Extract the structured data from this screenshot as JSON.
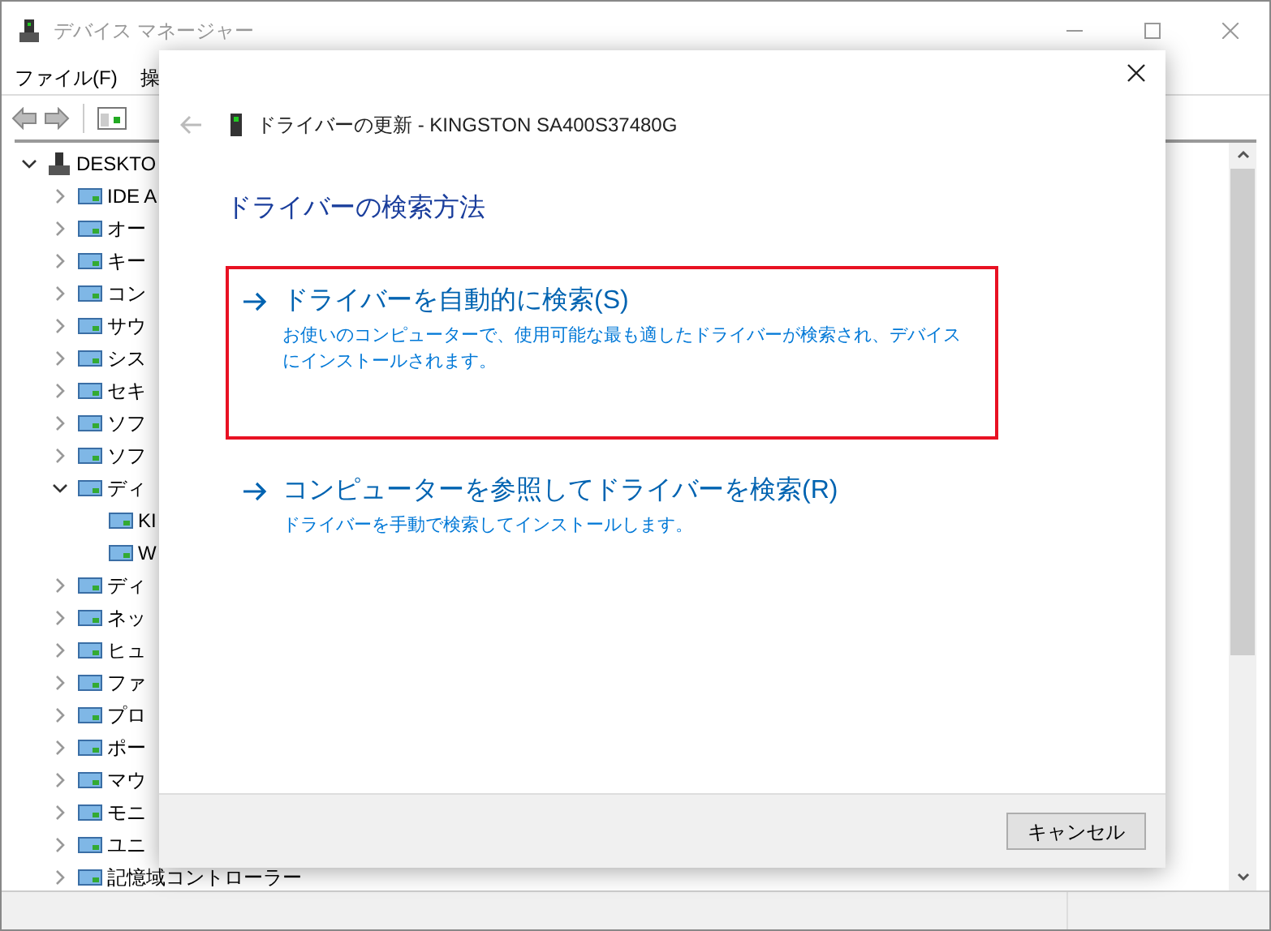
{
  "window": {
    "title": "デバイス マネージャー"
  },
  "menu": [
    "ファイル(F)",
    "操"
  ],
  "tree": [
    {
      "label": "DESKTO",
      "expanded": true,
      "children": [
        {
          "label": "IDE A",
          "expanded": false
        },
        {
          "label": "オー",
          "expanded": false
        },
        {
          "label": "キー",
          "expanded": false
        },
        {
          "label": "コン",
          "expanded": false
        },
        {
          "label": "サウ",
          "expanded": false
        },
        {
          "label": "シス",
          "expanded": false
        },
        {
          "label": "セキ",
          "expanded": false
        },
        {
          "label": "ソフ",
          "expanded": false
        },
        {
          "label": "ソフ",
          "expanded": false
        },
        {
          "label": "ディ",
          "expanded": true,
          "children": [
            {
              "label": "KI"
            },
            {
              "label": "W"
            }
          ]
        },
        {
          "label": "ディ",
          "expanded": false
        },
        {
          "label": "ネッ",
          "expanded": false
        },
        {
          "label": "ヒュ",
          "expanded": false
        },
        {
          "label": "ファ",
          "expanded": false
        },
        {
          "label": "プロ",
          "expanded": false
        },
        {
          "label": "ポー",
          "expanded": false
        },
        {
          "label": "マウ",
          "expanded": false
        },
        {
          "label": "モニ",
          "expanded": false
        },
        {
          "label": "ユニ",
          "expanded": false
        },
        {
          "label": "記憶域コントローラー",
          "expanded": false
        }
      ]
    }
  ],
  "dialog": {
    "title": "ドライバーの更新 - KINGSTON SA400S37480G",
    "heading": "ドライバーの検索方法",
    "options": [
      {
        "title": "ドライバーを自動的に検索(S)",
        "description": "お使いのコンピューターで、使用可能な最も適したドライバーが検索され、デバイスにインストールされます。",
        "selected": true
      },
      {
        "title": "コンピューターを参照してドライバーを検索(R)",
        "description": "ドライバーを手動で検索してインストールします。",
        "selected": false
      }
    ],
    "cancel": "キャンセル"
  }
}
